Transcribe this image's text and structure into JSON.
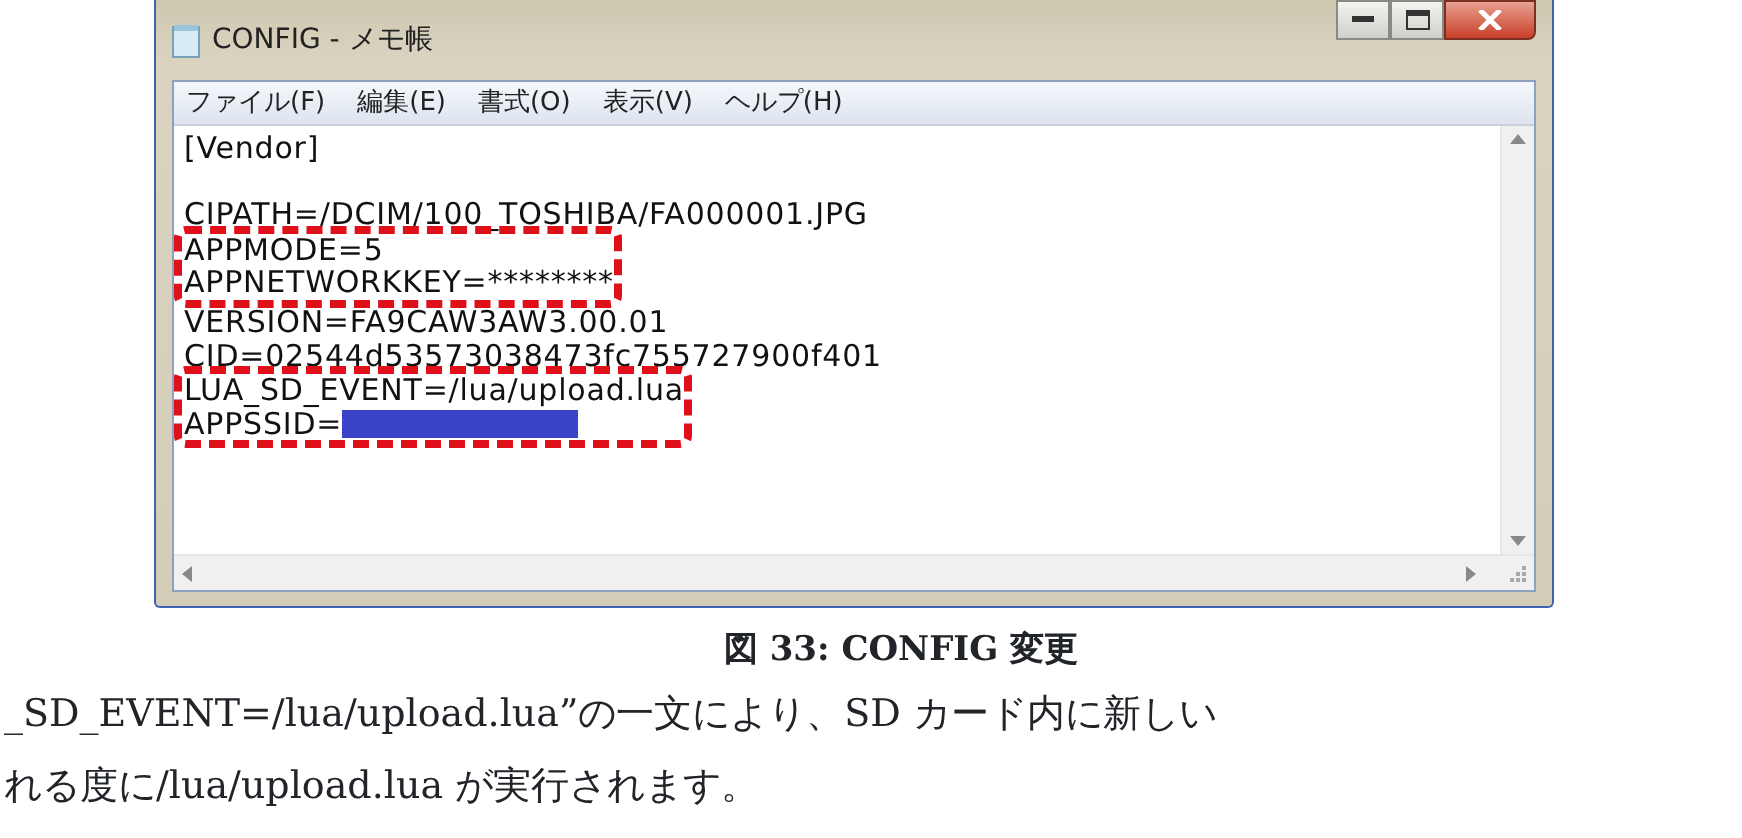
{
  "window": {
    "title": "CONFIG - メモ帳"
  },
  "menu": [
    "ファイル(F)",
    "編集(E)",
    "書式(O)",
    "表示(V)",
    "ヘルプ(H)"
  ],
  "content": [
    {
      "kind": "line",
      "text": "[Vendor]"
    },
    {
      "kind": "blank"
    },
    {
      "kind": "line",
      "text": "CIPATH=/DCIM/100_TOSHIBA/FA000001.JPG"
    },
    {
      "kind": "highlight",
      "lines": [
        {
          "text": "APPMODE=5",
          "redacted": false
        },
        {
          "text": "APPNETWORKKEY=********",
          "redacted": false
        }
      ]
    },
    {
      "kind": "line",
      "text": "VERSION=FA9CAW3AW3.00.01"
    },
    {
      "kind": "line",
      "text": "CID=02544d53573038473fc755727900f401"
    },
    {
      "kind": "highlight",
      "lines": [
        {
          "text": "LUA_SD_EVENT=/lua/upload.lua",
          "redacted": false
        },
        {
          "text": "APPSSID=",
          "redacted": true
        }
      ]
    }
  ],
  "caption": "図  33: CONFIG 変更",
  "paragraph": [
    "_SD_EVENT=/lua/upload.lua”の一文により、SD  カード内に新しい",
    "れる度に/lua/upload.lua が実行されます。"
  ]
}
